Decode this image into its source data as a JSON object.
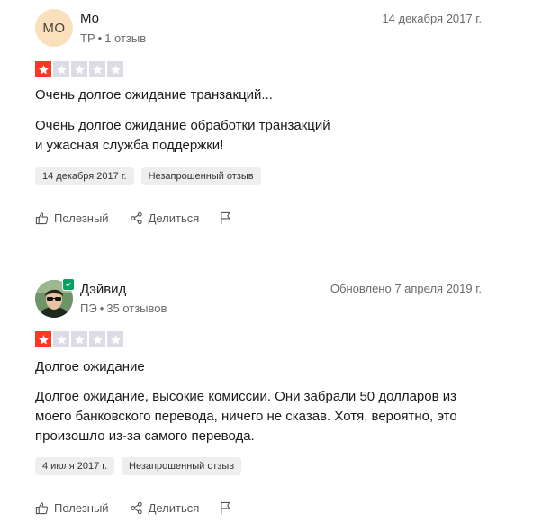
{
  "reviews": [
    {
      "avatar_initials": "MO",
      "name": "Мо",
      "country": "TP",
      "review_count": "1 отзыв",
      "date": "14 декабря 2017 г.",
      "rating": 1,
      "title": "Очень долгое ожидание транзакций...",
      "body_lines": [
        "Очень долгое ожидание обработки транзакций",
        "и ужасная служба поддержки!"
      ],
      "tags": [
        "14 декабря 2017 г.",
        "Незапрошенный отзыв"
      ],
      "actions": {
        "useful": "Полезный",
        "share": "Делиться"
      }
    },
    {
      "avatar_icon": "user-photo-avatar",
      "name": "Дэйвид",
      "country": "ПЭ",
      "review_count": "35 отзывов",
      "date": "Обновлено 7 апреля 2019 г.",
      "rating": 1,
      "title": "Долгое ожидание",
      "body_lines": [
        "Долгое ожидание, высокие комиссии. Они забрали 50 долларов из",
        "моего банковского перевода, ничего не сказав. Хотя, вероятно, это",
        "произошло из-за самого перевода."
      ],
      "tags": [
        "4 июля 2017 г.",
        "Незапрошенный отзыв"
      ],
      "actions": {
        "useful": "Полезный",
        "share": "Делиться"
      }
    }
  ],
  "colors": {
    "star_filled": "#ff3722",
    "star_empty": "#dcdce6",
    "avatar_bg": "#fbe0be",
    "verified": "#04a161"
  }
}
